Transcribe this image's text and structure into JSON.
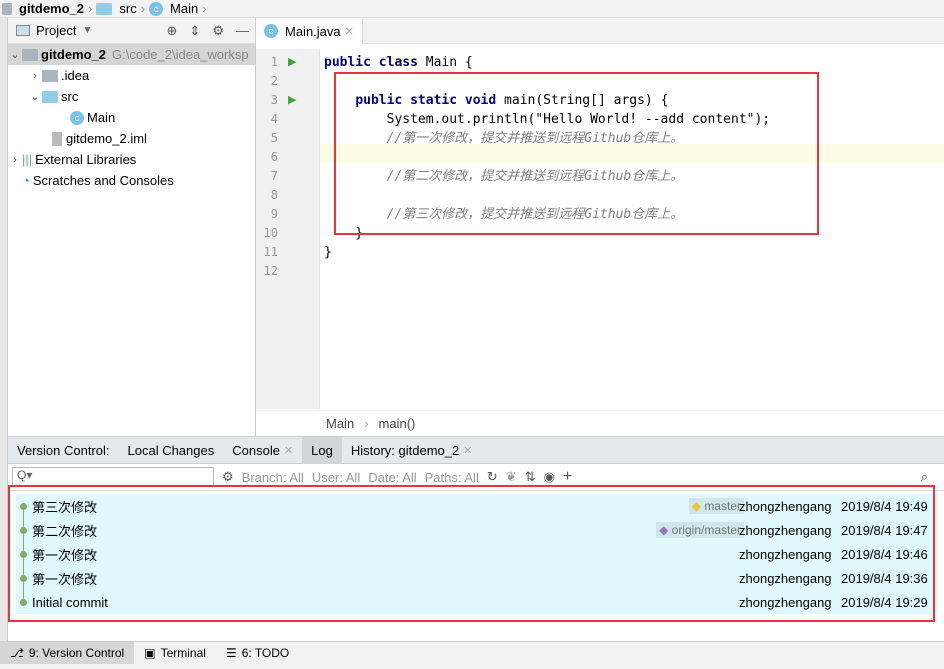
{
  "breadcrumb": [
    "gitdemo_2",
    "src",
    "Main"
  ],
  "project": {
    "title": "Project",
    "tree": [
      {
        "label": "gitdemo_2",
        "path": "G:\\code_2\\idea_worksp",
        "type": "module"
      },
      {
        "label": ".idea",
        "type": "folder"
      },
      {
        "label": "src",
        "type": "folder"
      },
      {
        "label": "Main",
        "type": "class"
      },
      {
        "label": "gitdemo_2.iml",
        "type": "file"
      },
      {
        "label": "External Libraries",
        "type": "libraries"
      },
      {
        "label": "Scratches and Consoles",
        "type": "scratches"
      }
    ]
  },
  "editor": {
    "tab": "Main.java",
    "breadcrumb": [
      "Main",
      "main()"
    ],
    "lines": [
      "public class Main {",
      "",
      "    public static void main(String[] args) {",
      "        System.out.println(\"Hello World! --add content\");",
      "        //第一次修改，提交并推送到远程Github仓库上。",
      "",
      "        //第二次修改，提交并推送到远程Github仓库上。",
      "",
      "        //第三次修改，提交并推送到远程Github仓库上。",
      "    }",
      "}",
      ""
    ]
  },
  "vc": {
    "tabs": [
      "Version Control:",
      "Local Changes",
      "Console",
      "Log",
      "History: gitdemo_2"
    ],
    "filters": {
      "branch": "Branch: All",
      "user": "User: All",
      "date": "Date: All",
      "paths": "Paths: All"
    },
    "commits": [
      {
        "message": "第三次修改",
        "tag": "master",
        "author": "zhongzhengang",
        "date": "2019/8/4 19:49"
      },
      {
        "message": "第二次修改",
        "tag": "origin/master",
        "author": "zhongzhengang",
        "date": "2019/8/4 19:47"
      },
      {
        "message": "第一次修改",
        "tag": "",
        "author": "zhongzhengang",
        "date": "2019/8/4 19:46"
      },
      {
        "message": "第一次修改",
        "tag": "",
        "author": "zhongzhengang",
        "date": "2019/8/4 19:36"
      },
      {
        "message": "Initial commit",
        "tag": "",
        "author": "zhongzhengang",
        "date": "2019/8/4 19:29"
      }
    ]
  },
  "bottombar": [
    "9: Version Control",
    "Terminal",
    "6: TODO"
  ],
  "colors": {
    "highlight_box": "#e8353b",
    "log_bg": "#e0f7fb",
    "master_tag": "#f2c230",
    "origin_tag": "#9a73c2"
  }
}
